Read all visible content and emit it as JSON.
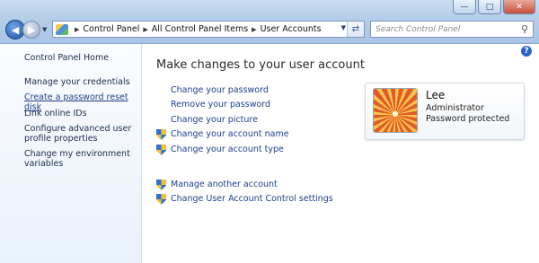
{
  "window": {
    "minimize_icon": "minimize-icon",
    "maximize_icon": "maximize-icon",
    "close_icon": "close-icon"
  },
  "nav": {
    "back_icon": "back-arrow-icon",
    "forward_icon": "forward-arrow-icon"
  },
  "breadcrumbs": [
    "Control Panel",
    "All Control Panel Items",
    "User Accounts"
  ],
  "search": {
    "placeholder": "Search Control Panel"
  },
  "sidebar": {
    "items": [
      {
        "label": "Control Panel Home"
      },
      {
        "label": "Manage your credentials"
      },
      {
        "label": "Create a password reset disk"
      },
      {
        "label": "Link online IDs"
      },
      {
        "label": "Configure advanced user profile properties"
      },
      {
        "label": "Change my environment variables"
      }
    ]
  },
  "main": {
    "heading": "Make changes to your user account",
    "tasks": [
      {
        "label": "Change your password",
        "shield": false
      },
      {
        "label": "Remove your password",
        "shield": false
      },
      {
        "label": "Change your picture",
        "shield": false
      },
      {
        "label": "Change your account name",
        "shield": true
      },
      {
        "label": "Change your account type",
        "shield": true
      }
    ],
    "other_tasks": [
      {
        "label": "Manage another account",
        "shield": true
      },
      {
        "label": "Change User Account Control settings",
        "shield": true
      }
    ]
  },
  "user": {
    "name": "Lee",
    "role": "Administrator",
    "status": "Password protected"
  },
  "colors": {
    "link": "#1c3f8e",
    "chrome": "#b4cde9",
    "sidebar": "#e9f1fb"
  }
}
